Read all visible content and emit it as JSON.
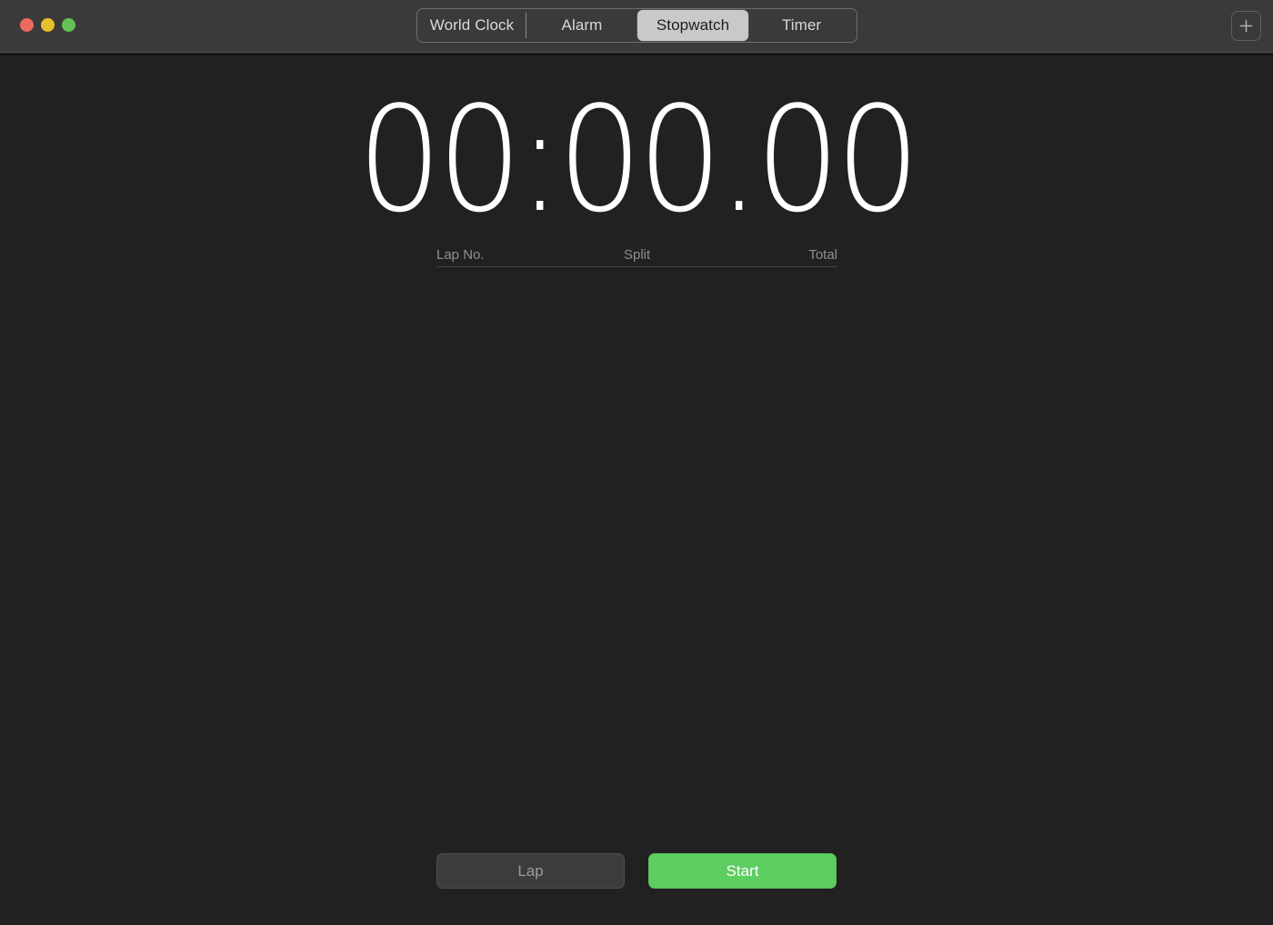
{
  "window": {
    "traffic_lights": [
      {
        "name": "close",
        "color": "#ec6a5f"
      },
      {
        "name": "minimize",
        "color": "#e6c02e"
      },
      {
        "name": "maximize",
        "color": "#62c354"
      }
    ]
  },
  "tabs": {
    "items": [
      {
        "label": "World Clock",
        "selected": false
      },
      {
        "label": "Alarm",
        "selected": false
      },
      {
        "label": "Stopwatch",
        "selected": true
      },
      {
        "label": "Timer",
        "selected": false
      }
    ],
    "selected": "Stopwatch",
    "selected_bg": "#c9c9c9",
    "selected_fg": "#1d1d1d"
  },
  "toolbar": {
    "add_icon": "plus-icon",
    "add_label": "+"
  },
  "stopwatch": {
    "display": "00:00.00",
    "hours_minutes": "00",
    "separator": ":",
    "seconds": "00",
    "decimal": ".",
    "hundredths": "00"
  },
  "lap_table": {
    "columns": [
      "Lap No.",
      "Split",
      "Total"
    ],
    "rows": []
  },
  "actions": {
    "lap_label": "Lap",
    "start_label": "Start",
    "start_color": "#5ece61",
    "lap_color": "#3c3c3c"
  }
}
